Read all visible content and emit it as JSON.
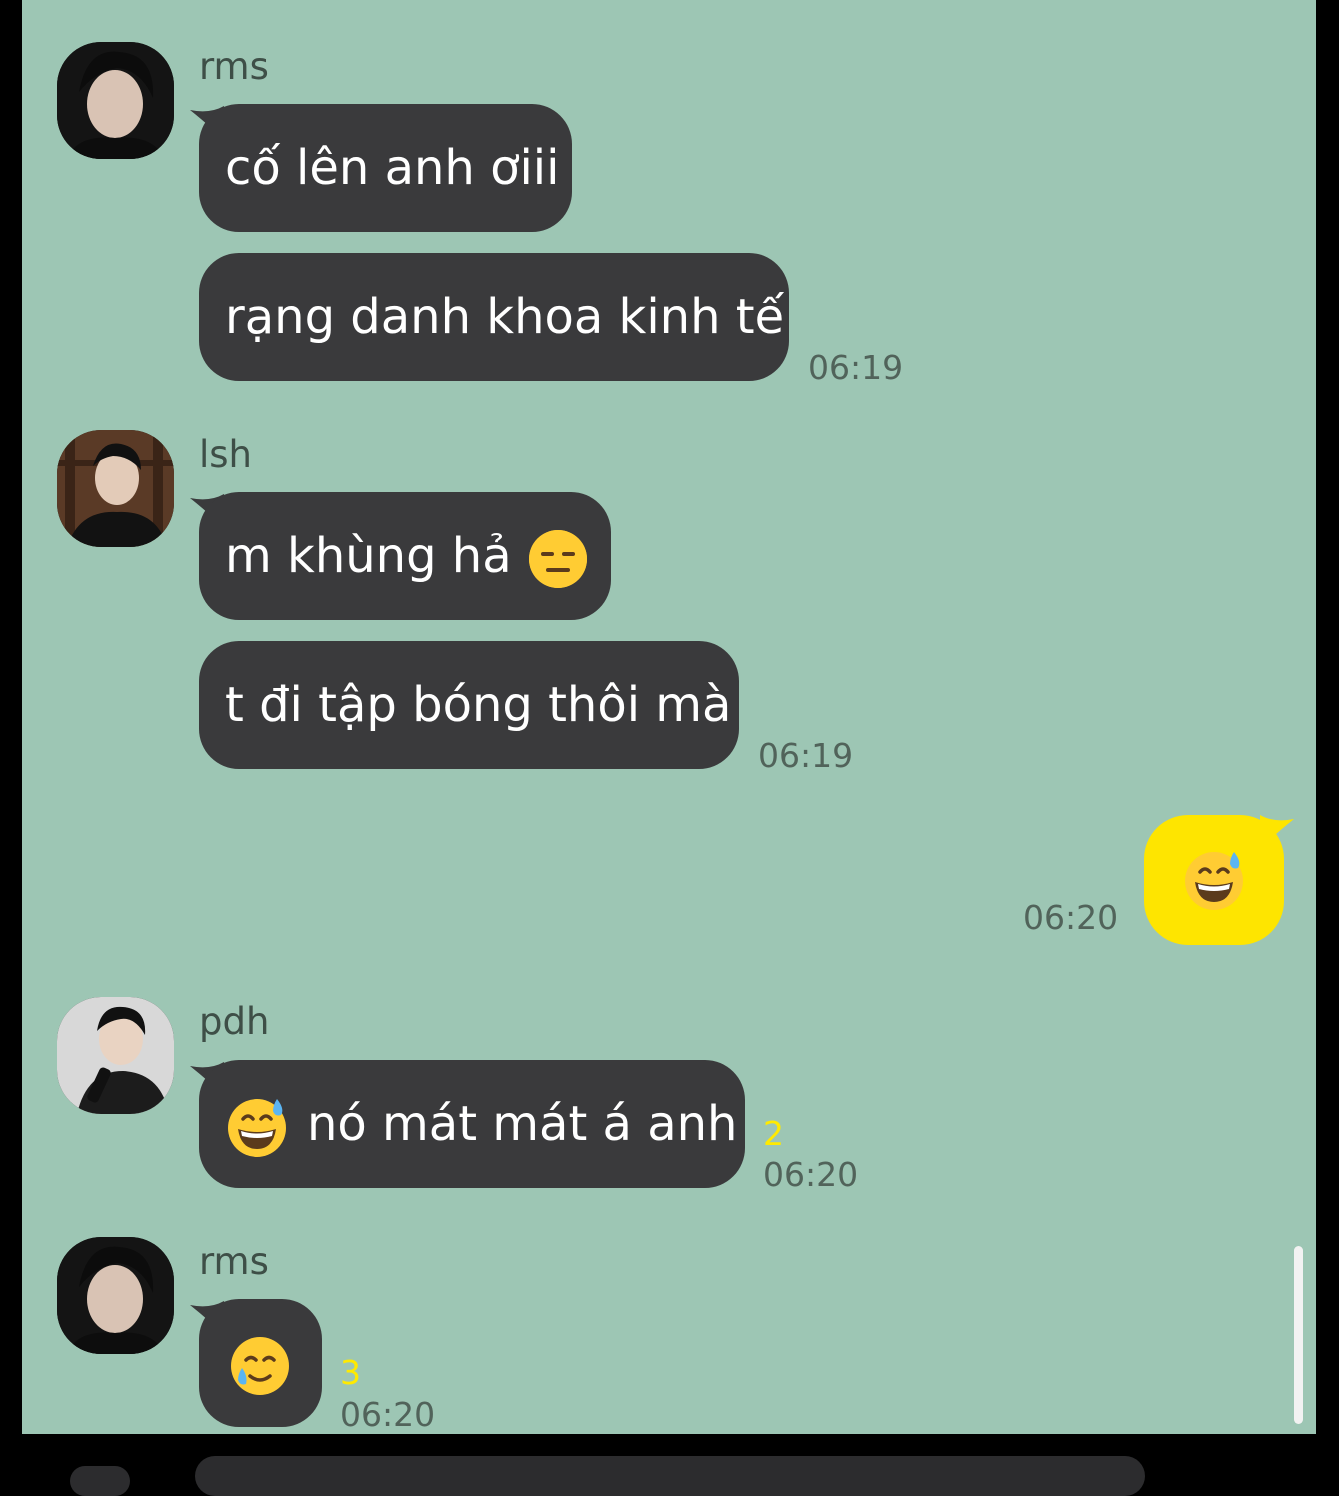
{
  "messages": [
    {
      "sender": "rms",
      "avatar_icon": "user-avatar-rms",
      "bubbles": [
        "cố lên anh ơiii",
        "rạng danh khoa kinh tế"
      ],
      "time": "06:19"
    },
    {
      "sender": "lsh",
      "avatar_icon": "user-avatar-lsh",
      "bubbles": [
        "m khùng hả",
        "t đi tập bóng thôi mà"
      ],
      "bubble_emoji": "expressionless-face-emoji",
      "time": "06:19"
    },
    {
      "sender": "me",
      "emoji": "grinning-sweat-emoji",
      "time": "06:20",
      "bubble_color": "#fee500"
    },
    {
      "sender": "pdh",
      "avatar_icon": "user-avatar-pdh",
      "bubbles": [
        "nó mát mát á anh"
      ],
      "bubble_emoji": "grinning-sweat-emoji",
      "unread": "2",
      "time": "06:20"
    },
    {
      "sender": "rms",
      "avatar_icon": "user-avatar-rms",
      "bubble_emoji": "smiling-tear-emoji",
      "unread": "3",
      "time": "06:20"
    }
  ],
  "colors": {
    "background": "#9dc6b4",
    "incoming_bubble": "#3a3a3c",
    "outgoing_bubble": "#fee500",
    "unread_count": "#ffea00"
  }
}
